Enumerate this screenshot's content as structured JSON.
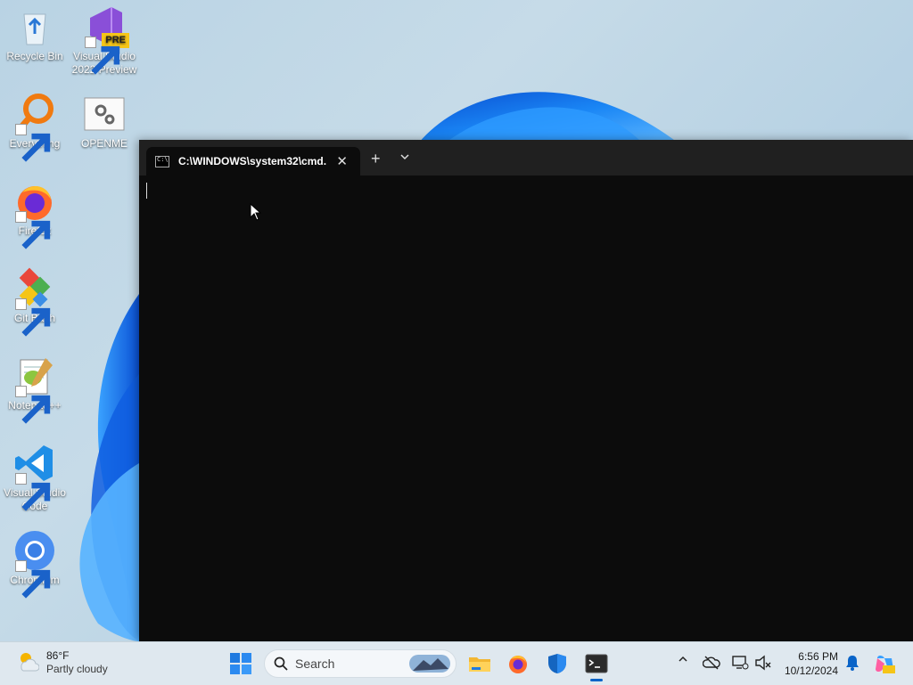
{
  "desktop": {
    "icons": [
      {
        "label": "Recycle Bin"
      },
      {
        "label": "Visual Studio 2022 Preview"
      },
      {
        "label": "Everything"
      },
      {
        "label": "OPENME"
      },
      {
        "label": "Firefox"
      },
      {
        "label": "Git Bash"
      },
      {
        "label": "Notepad++"
      },
      {
        "label": "Visual Studio Code"
      },
      {
        "label": "Chromium"
      }
    ],
    "vs_badge": "PRE"
  },
  "terminal": {
    "tab_title": "C:\\WINDOWS\\system32\\cmd.",
    "close_glyph": "✕",
    "newtab_glyph": "+"
  },
  "taskbar": {
    "weather": {
      "temp": "86°F",
      "condition": "Partly cloudy"
    },
    "search_placeholder": "Search",
    "clock": {
      "time": "6:56 PM",
      "date": "10/12/2024"
    },
    "tray_chevron": "^"
  },
  "colors": {
    "terminal_bg": "#0c0c0c",
    "titlebar_bg": "#202020",
    "taskbar_bg": "#dfe8ef",
    "accent": "#0a64c8"
  }
}
